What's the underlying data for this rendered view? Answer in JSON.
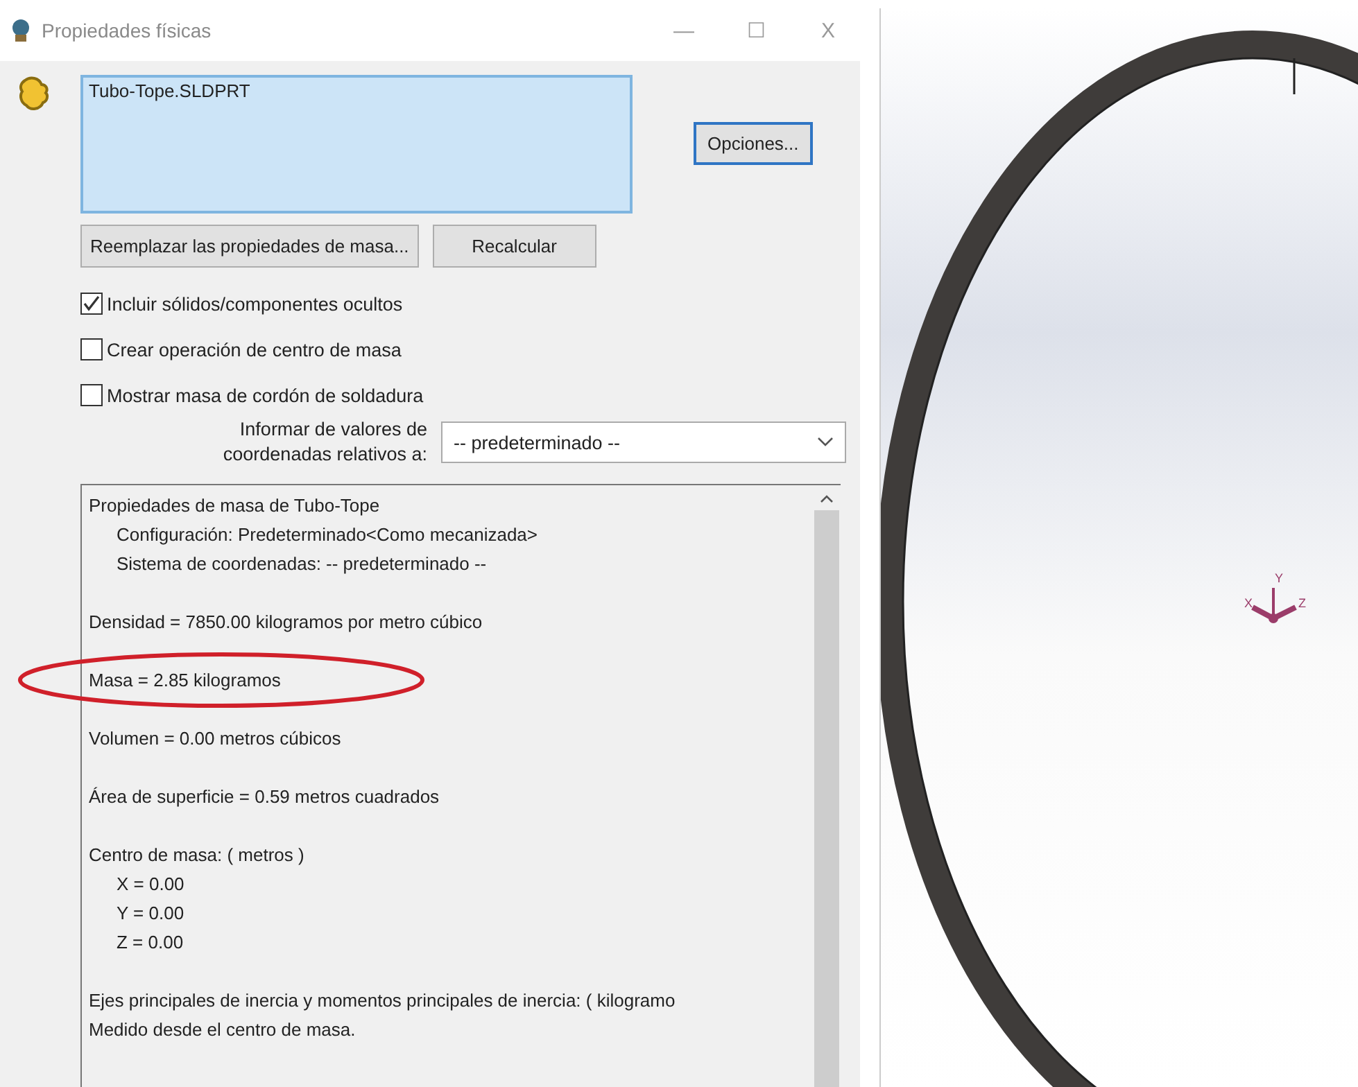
{
  "window": {
    "title": "Propiedades físicas",
    "controls": [
      "—",
      "☐",
      "X"
    ]
  },
  "selection": {
    "items": [
      "Tubo-Tope.SLDPRT"
    ]
  },
  "buttons": {
    "options": "Opciones...",
    "replace": "Reemplazar las propiedades de masa...",
    "recalc": "Recalcular"
  },
  "checkboxes": [
    {
      "label": "Incluir sólidos/componentes ocultos",
      "checked": true
    },
    {
      "label": "Crear operación de centro de masa",
      "checked": false
    },
    {
      "label": "Mostrar masa de cordón de soldadura",
      "checked": false
    }
  ],
  "coordinates": {
    "label_lines": [
      "Informar de valores de",
      "coordenadas relativos a:"
    ],
    "value": "-- predeterminado --"
  },
  "results": [
    [
      {
        "kind": "main",
        "text": "Propiedades de masa de Tubo-Tope"
      },
      {
        "kind": "sub",
        "text": "Configuración:  Predeterminado<Como mecanizada>"
      },
      {
        "kind": "sub",
        "text": "Sistema de coordenadas:  -- predeterminado --"
      }
    ],
    [
      {
        "kind": "main",
        "text": "Densidad = 7850.00 kilogramos por metro cúbico"
      }
    ],
    [
      {
        "kind": "main",
        "text": "Masa = 2.85 kilogramos",
        "highlighted": true
      }
    ],
    [
      {
        "kind": "main",
        "text": "Volumen = 0.00 metros cúbicos"
      }
    ],
    [
      {
        "kind": "main",
        "text": "Área de superficie = 0.59 metros cuadrados"
      }
    ],
    [
      {
        "kind": "main",
        "text": "Centro de masa: ( metros )"
      },
      {
        "kind": "sub",
        "text": "X = 0.00"
      },
      {
        "kind": "sub",
        "text": "Y = 0.00"
      },
      {
        "kind": "sub",
        "text": "Z = 0.00"
      }
    ],
    [
      {
        "kind": "main",
        "text": "Ejes principales de inercia y momentos principales de inercia: ( kilogramo"
      },
      {
        "kind": "main",
        "text": "Medido desde el centro de masa."
      }
    ]
  ],
  "viewport": {
    "axes": [
      "X",
      "Y",
      "Z"
    ]
  }
}
